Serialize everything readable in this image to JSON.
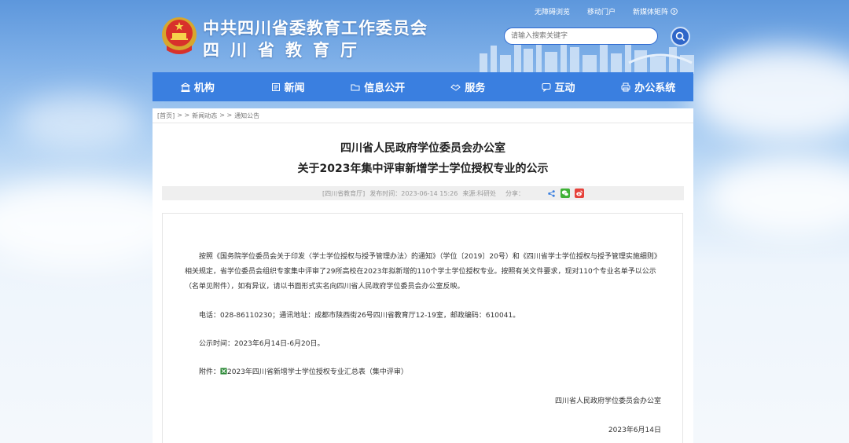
{
  "header": {
    "title_line1": "中共四川省委教育工作委员会",
    "title_line2": "四川省教育厅",
    "top_links": [
      "无障碍浏览",
      "移动门户",
      "新媒体矩阵"
    ],
    "search_placeholder": "请输入搜索关键字"
  },
  "nav": {
    "items": [
      {
        "label": "机构",
        "icon": "building-icon"
      },
      {
        "label": "新闻",
        "icon": "news-icon"
      },
      {
        "label": "信息公开",
        "icon": "folder-icon"
      },
      {
        "label": "服务",
        "icon": "handshake-icon"
      },
      {
        "label": "互动",
        "icon": "chat-icon"
      },
      {
        "label": "办公系统",
        "icon": "printer-icon"
      }
    ]
  },
  "breadcrumb": {
    "home": "[首页]",
    "sep": "> >",
    "level1": "新闻动态",
    "level2": "通知公告"
  },
  "article": {
    "title_line1": "四川省人民政府学位委员会办公室",
    "title_line2": "关于2023年集中评审新增学士学位授权专业的公示",
    "meta": {
      "source": "[四川省教育厅]",
      "published": "发布时间：2023-06-14 15:26",
      "origin": "来源:科研处",
      "share_label": "分享："
    },
    "paragraph1": "按照《国务院学位委员会关于印发〈学士学位授权与授予管理办法〉的通知》（学位〔2019〕20号）和《四川省学士学位授权与授予管理实施细则》相关规定，省学位委员会组织专家集中评审了29所高校在2023年拟新增的110个学士学位授权专业。按照有关文件要求，现对110个专业名单予以公示（名单见附件），如有异议，请以书面形式实名向四川省人民政府学位委员会办公室反映。",
    "paragraph2": "电话：028-86110230；通讯地址：成都市陕西街26号四川省教育厅12-19室，邮政编码：610041。",
    "paragraph3": "公示时间：2023年6月14日-6月20日。",
    "attachment_prefix": "附件：",
    "attachment_name": "2023年四川省新增学士学位授权专业汇总表（集中评审）",
    "signature": "四川省人民政府学位委员会办公室",
    "date": "2023年6月14日"
  },
  "colors": {
    "nav": "#3a7fe0",
    "search_border": "#2f6ad0",
    "wechat": "#3eb135",
    "weibo": "#e6423b"
  }
}
